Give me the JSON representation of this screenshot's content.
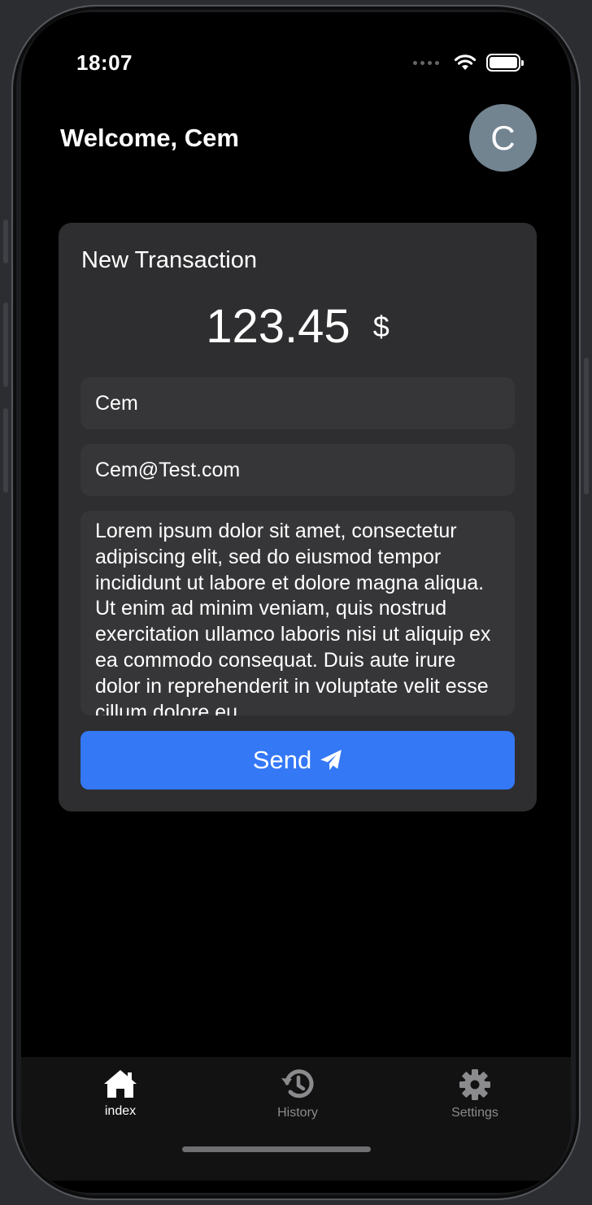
{
  "status": {
    "time": "18:07"
  },
  "header": {
    "welcome": "Welcome, Cem",
    "avatar_initial": "C"
  },
  "card": {
    "title": "New Transaction",
    "amount": "123.45",
    "currency": "$",
    "name_value": "Cem",
    "email_value": "Cem@Test.com",
    "note_value": "Lorem ipsum dolor sit amet, consectetur adipiscing elit, sed do eiusmod tempor incididunt ut labore et dolore magna aliqua. Ut enim ad minim veniam, quis nostrud exercitation ullamco laboris nisi ut aliquip ex ea commodo consequat. Duis aute irure dolor in reprehenderit in voluptate velit esse cillum dolore eu",
    "send_label": "Send"
  },
  "tabs": [
    {
      "label": "index",
      "icon": "home-icon",
      "active": true
    },
    {
      "label": "History",
      "icon": "history-icon",
      "active": false
    },
    {
      "label": "Settings",
      "icon": "gear-icon",
      "active": false
    }
  ],
  "colors": {
    "accent": "#3478f6",
    "card_bg": "#2e2e30",
    "field_bg": "#363638",
    "avatar_bg": "#738491",
    "tabbar_bg": "#121212"
  }
}
